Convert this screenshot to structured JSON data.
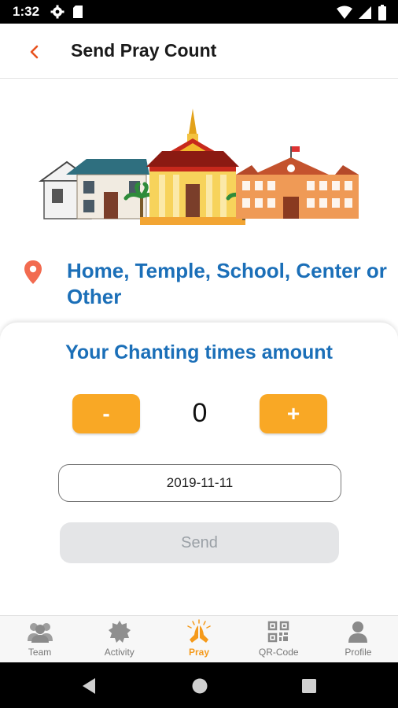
{
  "status_bar": {
    "time": "1:32"
  },
  "app_bar": {
    "title": "Send Pray Count"
  },
  "location": {
    "text": "Home, Temple, School, Center or Other"
  },
  "card": {
    "title": "Your Chanting times amount",
    "minus_label": "-",
    "plus_label": "+",
    "count": "0",
    "date": "2019-11-11",
    "send_label": "Send"
  },
  "bottom_nav": {
    "items": [
      {
        "label": "Team",
        "icon": "team-icon"
      },
      {
        "label": "Activity",
        "icon": "activity-icon"
      },
      {
        "label": "Pray",
        "icon": "pray-icon",
        "active": true
      },
      {
        "label": "QR-Code",
        "icon": "qr-code-icon"
      },
      {
        "label": "Profile",
        "icon": "profile-icon"
      }
    ]
  },
  "colors": {
    "accent": "#f9a825",
    "title_blue": "#1b6fb8",
    "active_nav": "#f59a1b",
    "back_arrow": "#e8531f"
  }
}
